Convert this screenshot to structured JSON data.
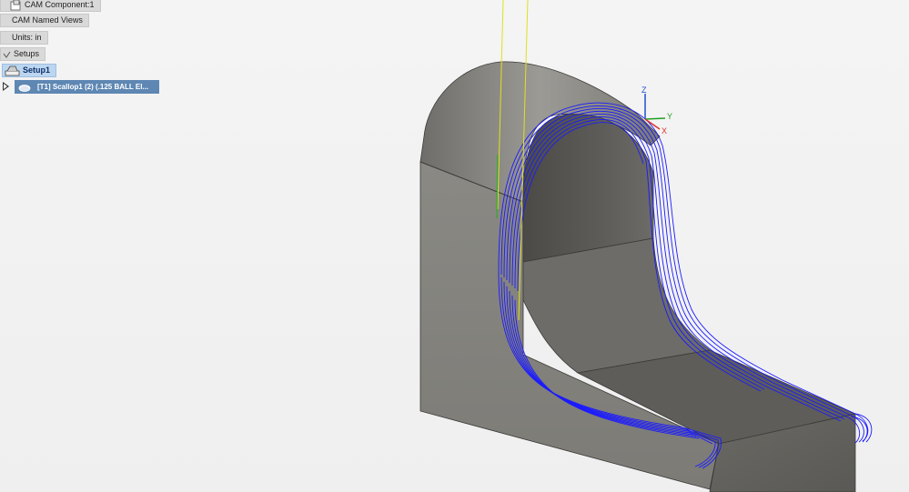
{
  "browser": {
    "items": [
      {
        "label": "CAM Component:1",
        "icon": "component-icon"
      },
      {
        "label": "CAM Named Views",
        "icon": ""
      },
      {
        "label": "Units: in",
        "icon": ""
      },
      {
        "label": "Setups",
        "icon": "folder-icon"
      },
      {
        "label": "Setup1",
        "icon": "setup-icon"
      }
    ],
    "operation": {
      "label": "[T1] Scallop1 (2) (.125 BALL El...",
      "icon": "scallop-tool-icon"
    }
  },
  "viewport": {
    "triad": {
      "x": "X",
      "y": "Y",
      "z": "Z"
    },
    "colors": {
      "toolpath": "#1a1aff",
      "tool_axis": "#e6e600",
      "part_light": "#8c8a85",
      "part_dark": "#5b5a56",
      "background": "#f2f2f2",
      "axis_x": "#e03030",
      "axis_y": "#20a020",
      "axis_z": "#2050d0"
    }
  }
}
